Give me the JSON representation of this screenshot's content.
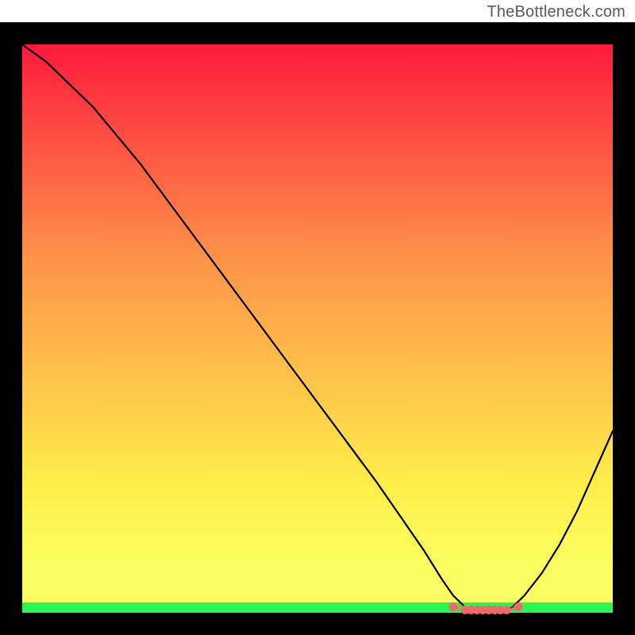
{
  "attribution": "TheBottleneck.com",
  "colors": {
    "black": "#000000",
    "curve": "#000000",
    "marker": "#ec6b66",
    "gradient_top": "#ff1a3c",
    "gradient_mid_upper": "#ff944a",
    "gradient_mid_lower": "#ffef4a",
    "gradient_low": "#faff63",
    "gradient_bottom": "#2bf553"
  },
  "chart_data": {
    "type": "line",
    "title": "",
    "xlabel": "",
    "ylabel": "",
    "xlim": [
      0,
      100
    ],
    "ylim": [
      0,
      100
    ],
    "series": [
      {
        "name": "curve",
        "x": [
          0,
          4,
          8,
          12,
          16,
          20,
          25,
          30,
          35,
          40,
          45,
          50,
          55,
          60,
          64,
          68,
          71,
          73,
          75,
          77,
          79,
          81,
          83,
          85,
          88,
          91,
          94,
          97,
          100
        ],
        "y": [
          100,
          97,
          93,
          89,
          84,
          79,
          72,
          65,
          58,
          51,
          44,
          37,
          30,
          23,
          17,
          11,
          6,
          3,
          1,
          0,
          0,
          0,
          1,
          3,
          7,
          12,
          18,
          25,
          32
        ]
      },
      {
        "name": "markers",
        "x": [
          73,
          75,
          76,
          77,
          78,
          79,
          80,
          81,
          82,
          84
        ],
        "y": [
          1,
          0.5,
          0.5,
          0.5,
          0.5,
          0.5,
          0.5,
          0.5,
          0.5,
          1
        ]
      }
    ]
  }
}
